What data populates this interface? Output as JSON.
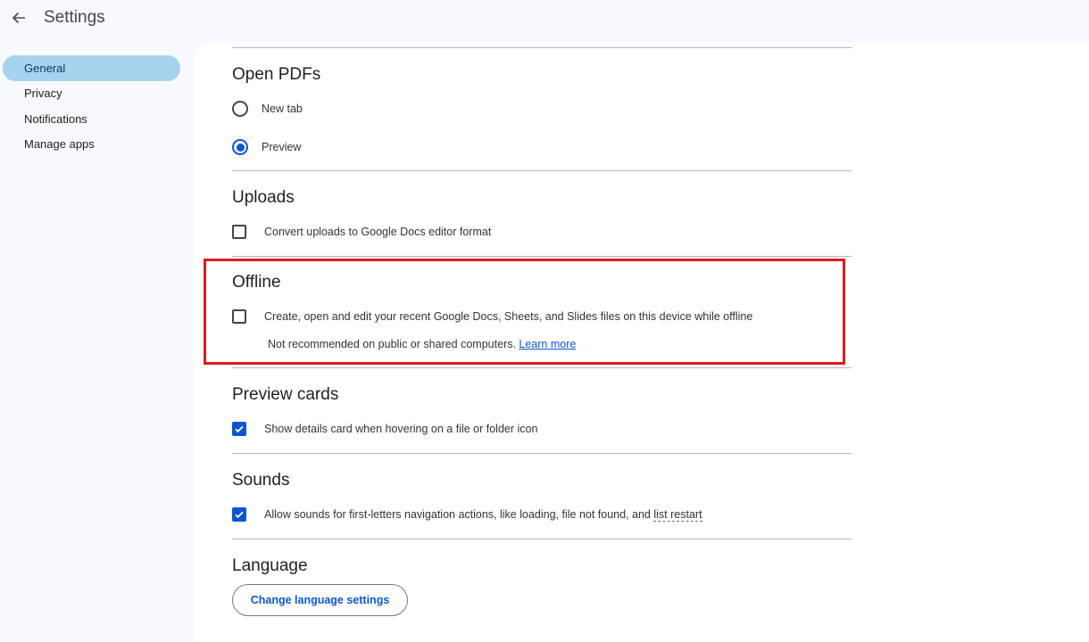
{
  "header": {
    "back_icon": "arrow-left-icon",
    "title": "Settings"
  },
  "sidebar": {
    "items": [
      {
        "label": "General",
        "active": true
      },
      {
        "label": "Privacy",
        "active": false
      },
      {
        "label": "Notifications",
        "active": false
      },
      {
        "label": "Manage apps",
        "active": false
      }
    ]
  },
  "sections": {
    "open_pdfs": {
      "title": "Open PDFs",
      "options": [
        {
          "label": "New tab",
          "selected": false
        },
        {
          "label": "Preview",
          "selected": true
        }
      ]
    },
    "uploads": {
      "title": "Uploads",
      "checkbox_label": "Convert uploads to Google Docs editor format",
      "checked": false
    },
    "offline": {
      "title": "Offline",
      "checkbox_label": "Create, open and edit your recent Google Docs, Sheets, and Slides files on this device while offline",
      "checked": false,
      "note": "Not recommended on public or shared computers.",
      "link": "Learn more"
    },
    "preview_cards": {
      "title": "Preview cards",
      "checkbox_label": "Show details card when hovering on a file or folder icon",
      "checked": true
    },
    "sounds": {
      "title": "Sounds",
      "checkbox_label_prefix": "Allow sounds for first-letters navigation actions, like loading, file not found, and",
      "checkbox_label_term": "list restart",
      "checked": true
    },
    "language": {
      "title": "Language",
      "button_label": "Change language settings"
    }
  },
  "colors": {
    "accent": "#0b57d0",
    "nav_active_bg": "#a8d3ee",
    "highlight_border": "#e0181f",
    "page_bg": "#f8f9fd"
  }
}
